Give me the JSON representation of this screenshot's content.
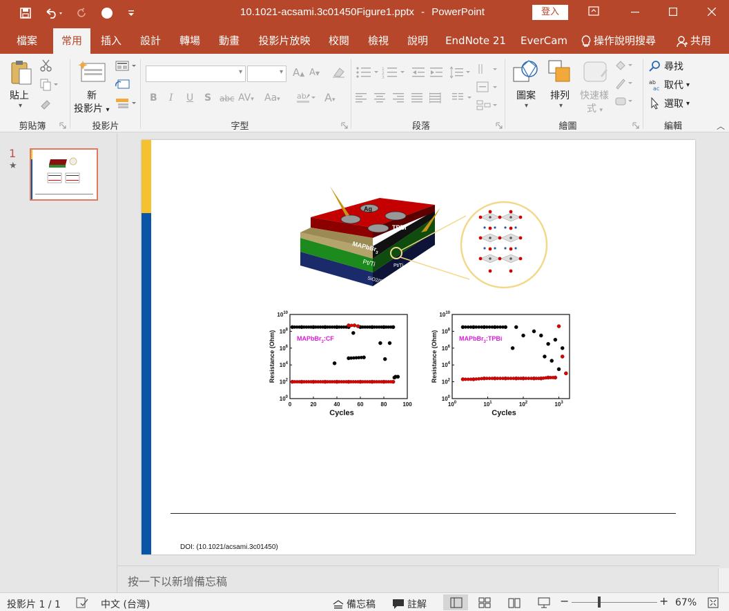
{
  "window": {
    "filename": "10.1021-acsami.3c01450Figure1.pptx",
    "separator": "-",
    "app": "PowerPoint",
    "login_label": "登入"
  },
  "tabs": [
    "檔案",
    "常用",
    "插入",
    "設計",
    "轉場",
    "動畫",
    "投影片放映",
    "校閱",
    "檢視",
    "說明",
    "EndNote 21",
    "EverCam"
  ],
  "active_tab": "常用",
  "tell_me": "操作說明搜尋",
  "share": "共用",
  "ribbon": {
    "clipboard": {
      "paste": "貼上",
      "label": "剪貼簿"
    },
    "slides": {
      "new_slide_line1": "新",
      "new_slide_line2": "投影片",
      "label": "投影片"
    },
    "font": {
      "label": "字型",
      "bold": "B",
      "italic": "I",
      "underline": "U",
      "shadow": "S",
      "strike": "abc",
      "spacing": "AV",
      "case": "Aa",
      "grow": "A",
      "shrink": "A"
    },
    "paragraph": {
      "label": "段落"
    },
    "drawing": {
      "shapes": "圖案",
      "arrange": "排列",
      "quick_styles_line1": "快速樣",
      "quick_styles_line2": "式",
      "label": "繪圖"
    },
    "editing": {
      "find": "尋找",
      "replace": "取代",
      "select": "選取",
      "label": "編輯"
    }
  },
  "thumbnail": {
    "number": "1",
    "star": "★"
  },
  "slide": {
    "doi": "DOI: (10.1021/acsami.3c01450)",
    "device_labels": {
      "ag": "Ag",
      "tpbi": "TPBI",
      "perovskite": "MAPbBr",
      "perovskite_sub": "3",
      "ptti": "Pt/Ti",
      "ptti_side": "Pt/Ti",
      "substrate": "SiO2/Si"
    }
  },
  "chart_data": [
    {
      "type": "scatter",
      "annotation": "MAPbBr3:CF",
      "xlabel": "Cycles",
      "ylabel": "Resistance (Ohm)",
      "x_ticks": [
        "0",
        "20",
        "40",
        "60",
        "80",
        "100"
      ],
      "y_ticks": [
        "10^0",
        "10^2",
        "10^4",
        "10^6",
        "10^8",
        "10^10"
      ],
      "xlim": [
        0,
        100
      ],
      "ylim_log10": [
        0,
        10
      ],
      "series": [
        {
          "color": "#000000",
          "x": [
            2,
            10,
            20,
            30,
            40,
            50,
            54,
            60,
            70,
            80,
            88,
            38,
            50,
            63,
            77,
            81,
            85,
            89,
            90,
            92
          ],
          "y_log10": [
            8.5,
            8.5,
            8.5,
            8.5,
            8.5,
            8.5,
            7.8,
            8.5,
            8.5,
            8.5,
            8.5,
            4.2,
            4.8,
            4.9,
            6.6,
            4.7,
            6.6,
            2.5,
            2.6,
            2.6
          ]
        },
        {
          "color": "#e00000",
          "x": [
            2,
            10,
            20,
            30,
            40,
            50,
            60,
            70,
            80,
            88,
            50,
            55,
            58
          ],
          "y_log10": [
            2.0,
            2.0,
            2.0,
            2.0,
            2.0,
            2.0,
            2.0,
            2.0,
            2.0,
            2.0,
            8.7,
            8.7,
            8.6
          ]
        }
      ]
    },
    {
      "type": "scatter",
      "annotation": "MAPbBr3:TPBi",
      "xlabel": "Cycles",
      "ylabel": "Resistance (Ohm)",
      "x_ticks": [
        "10^0",
        "10^1",
        "10^2",
        "10^3"
      ],
      "y_ticks": [
        "10^0",
        "10^2",
        "10^4",
        "10^6",
        "10^8",
        "10^10"
      ],
      "x_scale": "log",
      "xlim_log10": [
        0,
        3.3
      ],
      "ylim_log10": [
        0,
        10
      ],
      "series": [
        {
          "color": "#000000",
          "x_log10": [
            0.3,
            0.6,
            0.9,
            1.2,
            1.5,
            1.7,
            1.8,
            2.0,
            2.3,
            2.5,
            2.6,
            2.7,
            2.8,
            2.9,
            3.0,
            3.1
          ],
          "y_log10": [
            8.5,
            8.5,
            8.5,
            8.5,
            8.5,
            6.0,
            8.5,
            7.5,
            8.0,
            7.5,
            5.0,
            6.5,
            4.5,
            7.0,
            3.5,
            6.0
          ]
        },
        {
          "color": "#e00000",
          "x_log10": [
            0.3,
            0.6,
            0.9,
            1.2,
            1.5,
            1.8,
            2.0,
            2.3,
            2.5,
            2.7,
            2.9,
            3.0,
            3.1,
            3.2
          ],
          "y_log10": [
            2.3,
            2.3,
            2.4,
            2.4,
            2.4,
            2.4,
            2.4,
            2.4,
            2.4,
            2.5,
            2.5,
            8.6,
            5.0,
            3.0
          ]
        }
      ]
    }
  ],
  "notes_placeholder": "按一下以新增備忘稿",
  "status": {
    "slide_info": "投影片 1 / 1",
    "language": "中文 (台灣)",
    "notes": "備忘稿",
    "comments": "註解",
    "zoom": "67%"
  },
  "colors": {
    "accent": "#b7472a",
    "slide_yellow": "#f6c12f",
    "slide_blue": "#0a55a5"
  }
}
